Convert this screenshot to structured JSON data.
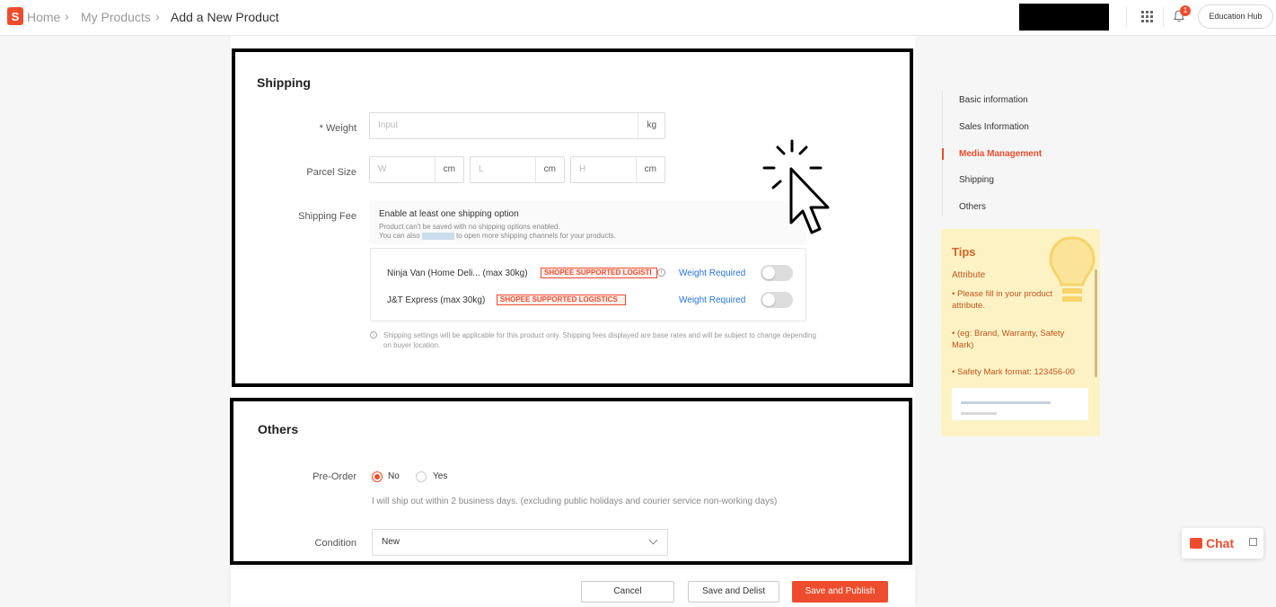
{
  "header": {
    "logo_letter": "S",
    "breadcrumb": [
      "Home",
      "My Products",
      "Add a New Product"
    ],
    "notification_count": "1",
    "education_hub": "Education Hub"
  },
  "shipping": {
    "title": "Shipping",
    "weight_label": "* Weight",
    "weight_placeholder": "Input",
    "weight_unit": "kg",
    "parcel_label": "Parcel Size",
    "parcel_w": "W",
    "parcel_l": "L",
    "parcel_h": "H",
    "parcel_unit": "cm",
    "fee_label": "Shipping Fee",
    "enable_title": "Enable at least one shipping option",
    "enable_sub1": "Product can't be saved with no shipping options enabled.",
    "enable_sub2_pre": "You can also",
    "enable_sub2_post": "to open more shipping channels for your products.",
    "channels": [
      {
        "name": "Ninja Van (Home Deli...  (max 30kg)",
        "tag": "SHOPEE SUPPORTED LOGISTI",
        "action": "Weight Required",
        "enabled": false
      },
      {
        "name": "J&T Express  (max 30kg)",
        "tag": "SHOPEE SUPPORTED LOGISTICS",
        "action": "Weight Required",
        "enabled": false
      }
    ],
    "note": "Shipping settings will be applicable for this product only. Shipping fees displayed are base rates and will be subject to change depending on buyer location."
  },
  "others": {
    "title": "Others",
    "preorder_label": "Pre-Order",
    "preorder_no": "No",
    "preorder_yes": "Yes",
    "preorder_selected": "No",
    "preorder_hint": "I will ship out within 2 business days. (excluding public holidays and courier service non-working days)",
    "condition_label": "Condition",
    "condition_value": "New"
  },
  "actions": {
    "cancel": "Cancel",
    "save_delist": "Save and Delist",
    "save_publish": "Save and Publish"
  },
  "right_nav": {
    "items": [
      "Basic information",
      "Sales Information",
      "Media Management",
      "Shipping",
      "Others"
    ],
    "active": "Media Management"
  },
  "tips": {
    "title": "Tips",
    "subtitle": "Attribute",
    "items": [
      "• Please fill in your product attribute.",
      "• (eg: Brand, Warranty, Safety Mark)",
      "• Safety Mark format: 123456-00"
    ]
  },
  "chat": {
    "label": "Chat"
  },
  "colors": {
    "accent": "#ee4d2d",
    "link": "#2673dd",
    "tips_bg": "#fdf2c4"
  }
}
